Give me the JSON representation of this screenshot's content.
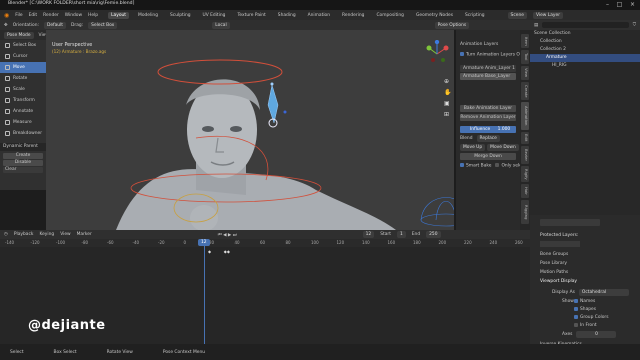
{
  "window": {
    "title": "Blender* [C:\\WORK FOLDER\\short mia\\rig\\Femie.blend]"
  },
  "menu": {
    "items": [
      "File",
      "Edit",
      "Render",
      "Window",
      "Help"
    ],
    "workspaces": [
      "Layout",
      "Modeling",
      "Sculpting",
      "UV Editing",
      "Texture Paint",
      "Shading",
      "Animation",
      "Rendering",
      "Compositing",
      "Geometry Nodes",
      "Scripting"
    ],
    "active_workspace": "Layout",
    "scene": "Scene",
    "view_layer": "View Layer"
  },
  "viewport_header": {
    "mode": "Pose Mode",
    "orientation_label": "Orientation:",
    "orientation": "Default",
    "drag": "Drag:",
    "select_box": "Select Box",
    "transform": "Local",
    "menus": [
      "View",
      "Select",
      "Pose"
    ],
    "options": "Pose Options"
  },
  "viewport": {
    "title": "User Perspective",
    "subtitle": "(12) Armature : Brazo.ags"
  },
  "toolbar": {
    "tools": [
      "Select Box",
      "Cursor",
      "Move",
      "Rotate",
      "Scale",
      "Transform",
      "Annotate",
      "Measure",
      "Breakdowner"
    ],
    "active": "Move",
    "dynamic_parent": {
      "title": "Dynamic Parent",
      "create": "Create",
      "disable": "Disable",
      "clear": "Clear"
    }
  },
  "npanel": {
    "title": "Animation Layers",
    "turn_on": "Turn Animation Layers On",
    "layers": [
      "Armature Anim_Layer 1",
      "Armature Base_Layer"
    ],
    "selected_layer": "Armature Base_Layer",
    "buttons": [
      "Bake Animation Layer",
      "Remove Animation Layer"
    ],
    "influence_label": "Influence",
    "influence_value": "1.000",
    "blend_label": "Blend",
    "blend_value": "Replace",
    "move_up": "Move Up",
    "move_down": "Move Down",
    "merge": "Merge Down",
    "smart_bake": "Smart Bake",
    "only_selected": "Only selecte"
  },
  "vertical_tabs": [
    "Item",
    "Tool",
    "View",
    "Create",
    "Animation",
    "Edit",
    "Bezier",
    "Rigify",
    "Hair",
    "Rigging"
  ],
  "outliner": {
    "rows": [
      "Scene Collection",
      "Collection",
      "Collection 2",
      "Armature",
      "HI_RIG"
    ],
    "selected": "Armature"
  },
  "properties": {
    "protected_layers": "Protected Layers:",
    "sections": [
      "Bone Groups",
      "Pose Library",
      "Motion Paths",
      "Viewport Display"
    ],
    "display_as_label": "Display As",
    "display_as": "Octahedral",
    "show_label": "Show",
    "show_options": [
      "Names",
      "Shapes",
      "Group Colors",
      "In Front"
    ],
    "axes_label": "Axes",
    "axes_value": "0",
    "footer": "Inverse Kinematics"
  },
  "timeline": {
    "menus": [
      "Playback",
      "Keying",
      "View",
      "Marker"
    ],
    "current_frame": "12",
    "start_label": "Start",
    "start": "1",
    "end_label": "End",
    "end": "250",
    "ticks": [
      "-140",
      "-120",
      "-100",
      "-80",
      "-60",
      "-40",
      "-20",
      "0",
      "20",
      "40",
      "60",
      "80",
      "100",
      "120",
      "140",
      "160",
      "180",
      "200",
      "220",
      "240",
      "260"
    ],
    "playhead_value": 12
  },
  "status": {
    "items": [
      "Select",
      "Box Select",
      "Rotate View",
      "Pose Context Menu"
    ]
  },
  "watermark": "@dejiante"
}
